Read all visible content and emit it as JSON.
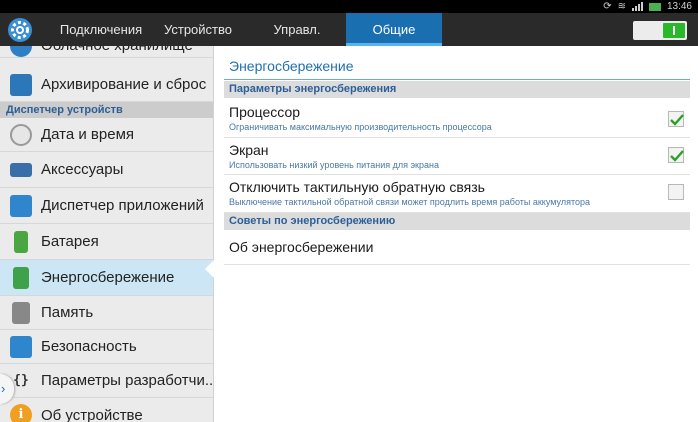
{
  "status_bar": {
    "time": "13:46"
  },
  "tabs": [
    {
      "label": "Подключения"
    },
    {
      "label": "Устройство"
    },
    {
      "label": "Управл."
    },
    {
      "label": "Общие"
    }
  ],
  "sidebar": {
    "items": [
      {
        "label": "Облачное хранилище"
      },
      {
        "label": "Архивирование и сброс"
      },
      {
        "label": "Дата и время"
      },
      {
        "label": "Аксессуары"
      },
      {
        "label": "Диспетчер приложений"
      },
      {
        "label": "Батарея"
      },
      {
        "label": "Энергосбережение"
      },
      {
        "label": "Память"
      },
      {
        "label": "Безопасность"
      },
      {
        "label": "Параметры разработчи.."
      },
      {
        "label": "Об устройстве"
      }
    ],
    "header_devices": "Диспетчер устройств"
  },
  "content": {
    "title": "Энергосбережение",
    "section_params": "Параметры энергосбережения",
    "section_tips": "Советы по энергосбережению",
    "rows": [
      {
        "title": "Процессор",
        "subtitle": "Ограничивать максимальную производительность процессора",
        "checked": true
      },
      {
        "title": "Экран",
        "subtitle": "Использовать низкий уровень питания для экрана",
        "checked": true
      },
      {
        "title": "Отключить тактильную обратную связь",
        "subtitle": "Выключение тактильной обратной связи может продлить время работы аккумулятора",
        "checked": false
      }
    ],
    "about": "Об энергосбережении"
  }
}
